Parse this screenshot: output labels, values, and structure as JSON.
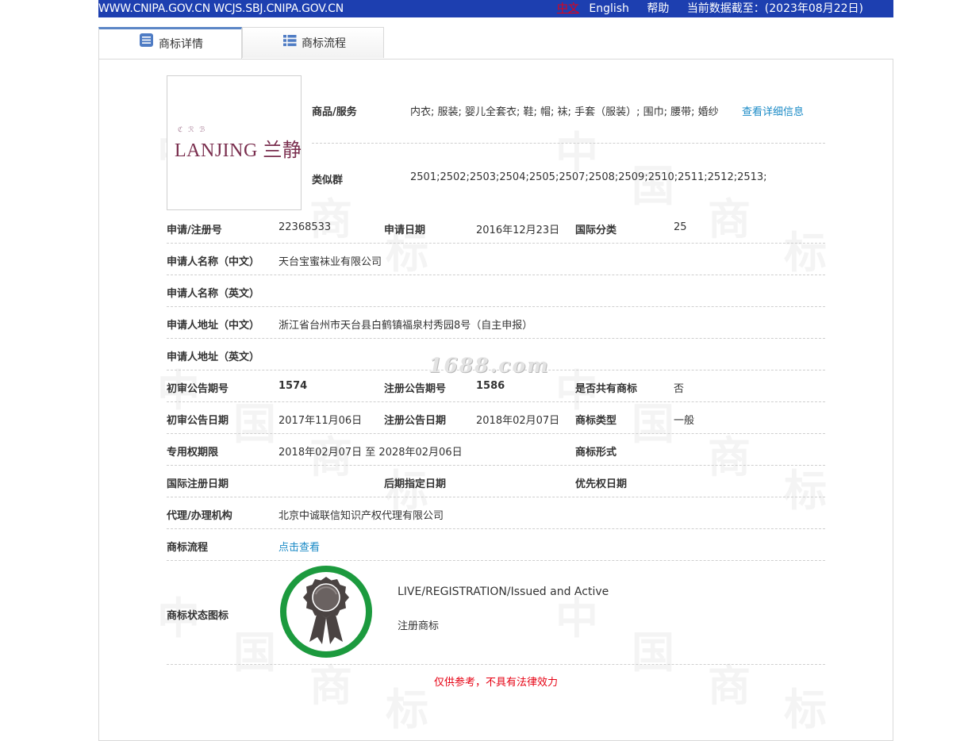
{
  "topbar": {
    "site": "WWW.CNIPA.GOV.CN WCJS.SBJ.CNIPA.GOV.CN",
    "lang_cn": "中文",
    "lang_en": "English",
    "help": "帮助",
    "data_date": "当前数据截至：(2023年08月22日)"
  },
  "tabs": [
    {
      "label": "商标详情",
      "active": true
    },
    {
      "label": "商标流程",
      "active": false
    }
  ],
  "logo": {
    "text": "LANJING 兰静",
    "deco": "ℭ ℛ ℬ"
  },
  "watermark": {
    "site": "1688.com",
    "chars": [
      "中",
      "国",
      "商",
      "标"
    ]
  },
  "goods": {
    "label": "商品/服务",
    "value": "内衣; 服装; 婴儿全套衣; 鞋; 帽; 袜; 手套（服装）; 围巾; 腰带; 婚纱",
    "link": "查看详细信息"
  },
  "similar": {
    "label": "类似群",
    "value": "2501;2502;2503;2504;2505;2507;2508;2509;2510;2511;2512;2513;"
  },
  "fields": {
    "reg_no_label": "申请/注册号",
    "reg_no": "22368533",
    "app_date_label": "申请日期",
    "app_date": "2016年12月23日",
    "intl_class_label": "国际分类",
    "intl_class": "25",
    "applicant_cn_label": "申请人名称（中文）",
    "applicant_cn": "天台宝蜜袜业有限公司",
    "applicant_en_label": "申请人名称（英文）",
    "address_cn_label": "申请人地址（中文）",
    "address_cn": "浙江省台州市天台县白鹤镇福泉村秀园8号（自主申报）",
    "address_en_label": "申请人地址（英文）",
    "prelim_no_label": "初审公告期号",
    "prelim_no": "1574",
    "reg_pub_no_label": "注册公告期号",
    "reg_pub_no": "1586",
    "shared_label": "是否共有商标",
    "shared": "否",
    "prelim_date_label": "初审公告日期",
    "prelim_date": "2017年11月06日",
    "reg_pub_date_label": "注册公告日期",
    "reg_pub_date": "2018年02月07日",
    "type_label": "商标类型",
    "type": "一般",
    "term_label": "专用权期限",
    "term": "2018年02月07日 至 2028年02月06日",
    "form_label": "商标形式",
    "intl_reg_date_label": "国际注册日期",
    "later_date_label": "后期指定日期",
    "priority_label": "优先权日期",
    "agent_label": "代理/办理机构",
    "agent": "北京中诚联信知识产权代理有限公司",
    "process_label": "商标流程",
    "process_link": "点击查看",
    "status_icon_label": "商标状态图标"
  },
  "status": {
    "en": "LIVE/REGISTRATION/Issued and Active",
    "cn": "注册商标"
  },
  "disclaimer": "仅供参考，不具有法律效力",
  "colors": {
    "topbar": "#1d3fb0",
    "link": "#1a8ac6",
    "status_ring": "#1c9a3e",
    "disclaimer": "#e60012"
  }
}
